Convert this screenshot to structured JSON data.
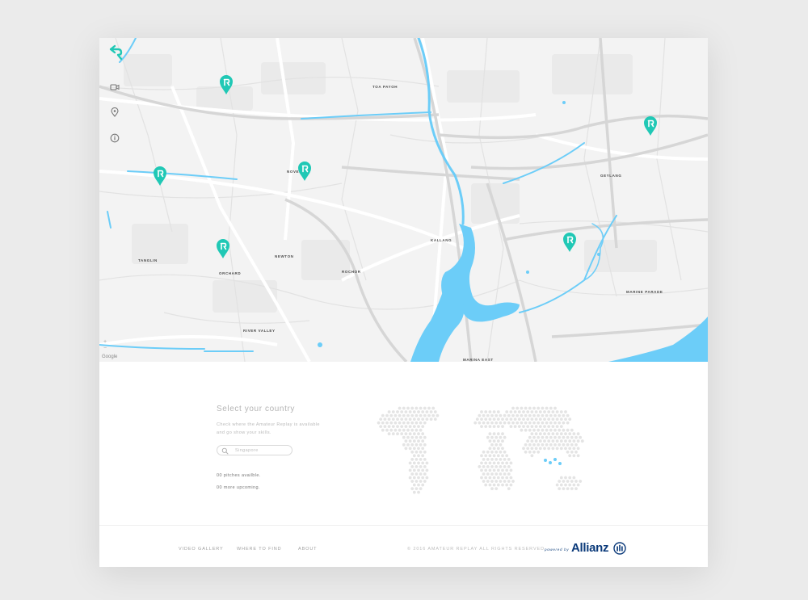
{
  "colors": {
    "accent": "#20c8b5",
    "water": "#6ccdf8",
    "brand_blue": "#0b3a7a",
    "road": "#ffffff",
    "land": "#f3f3f3"
  },
  "map": {
    "areas": [
      {
        "name": "TOA PAYOH"
      },
      {
        "name": "NOVENA"
      },
      {
        "name": "GEYLANG"
      },
      {
        "name": "KALLANG"
      },
      {
        "name": "TANGLIN"
      },
      {
        "name": "NEWTON"
      },
      {
        "name": "ORCHARD"
      },
      {
        "name": "ROCHOR"
      },
      {
        "name": "RIVER VALLEY"
      },
      {
        "name": "MARINE PARADE"
      },
      {
        "name": "MARINA EAST"
      }
    ],
    "google_label": "Google",
    "zoom_plus": "+",
    "zoom_minus": "−"
  },
  "sidebar": {
    "icons": [
      "back-arrow-logo-icon",
      "video-camera-icon",
      "location-pin-icon",
      "info-icon"
    ]
  },
  "finder": {
    "title": "Select your country",
    "description": "Check where the Amateur Replay is available and go show your skills.",
    "search_placeholder": "Singapore",
    "pitches_available": "00 pitches availble.",
    "more_upcoming": "00 more upcoming."
  },
  "footer": {
    "nav": [
      "VIDEO GALLERY",
      "WHERE TO FIND",
      "ABOUT"
    ],
    "copyright": "© 2016 AMATEUR REPLAY All rights reserved",
    "powered_by": "powered by",
    "sponsor": "Allianz"
  }
}
